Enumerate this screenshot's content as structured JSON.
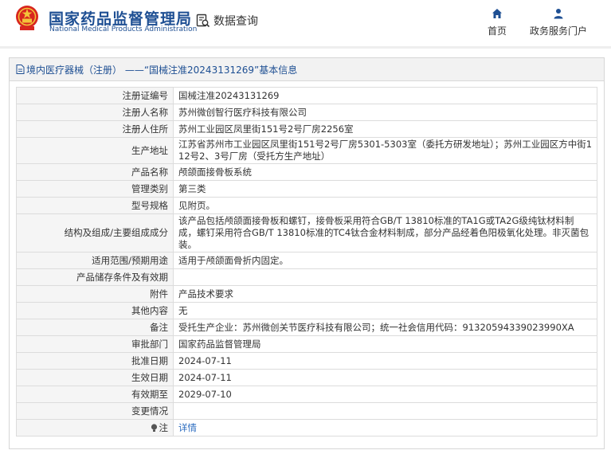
{
  "header": {
    "org_name_cn": "国家药品监督管理局",
    "org_name_en": "National Medical Products Administration",
    "query_tab": "数据查询",
    "nav": [
      {
        "label": "首页",
        "icon": "home-icon"
      },
      {
        "label": "政务服务门户",
        "icon": "user-icon"
      }
    ],
    "accent_color": "#1e4f93"
  },
  "panel": {
    "title": "境内医疗器械（注册） ——“国械注准20243131269”基本信息"
  },
  "details": {
    "rows": [
      {
        "label": "注册证编号",
        "value": "国械注准20243131269"
      },
      {
        "label": "注册人名称",
        "value": "苏州微创智行医疗科技有限公司"
      },
      {
        "label": "注册人住所",
        "value": "苏州工业园区凤里街151号2号厂房2256室"
      },
      {
        "label": "生产地址",
        "value": "江苏省苏州市工业园区凤里街151号2号厂房5301-5303室（委托方研发地址）；苏州工业园区方中街112号2、3号厂房（受托方生产地址）"
      },
      {
        "label": "产品名称",
        "value": "颅颌面接骨板系统"
      },
      {
        "label": "管理类别",
        "value": "第三类"
      },
      {
        "label": "型号规格",
        "value": "见附页。"
      },
      {
        "label": "结构及组成/主要组成成分",
        "value": "该产品包括颅颌面接骨板和螺钉，接骨板采用符合GB/T 13810标准的TA1G或TA2G级纯钛材料制成，螺钉采用符合GB/T 13810标准的TC4钛合金材料制成，部分产品经着色阳极氧化处理。非灭菌包装。"
      },
      {
        "label": "适用范围/预期用途",
        "value": "适用于颅颌面骨折内固定。"
      },
      {
        "label": "产品储存条件及有效期",
        "value": ""
      },
      {
        "label": "附件",
        "value": "产品技术要求"
      },
      {
        "label": "其他内容",
        "value": "无"
      },
      {
        "label": "备注",
        "value": "受托生产企业：苏州微创关节医疗科技有限公司；统一社会信用代码：91320594339023990XA"
      },
      {
        "label": "审批部门",
        "value": "国家药品监督管理局"
      },
      {
        "label": "批准日期",
        "value": "2024-07-11"
      },
      {
        "label": "生效日期",
        "value": "2024-07-11"
      },
      {
        "label": "有效期至",
        "value": "2029-07-10"
      },
      {
        "label": "变更情况",
        "value": ""
      }
    ],
    "note_row": {
      "label": "注",
      "icon": "bulb-icon",
      "link": "详情"
    }
  }
}
